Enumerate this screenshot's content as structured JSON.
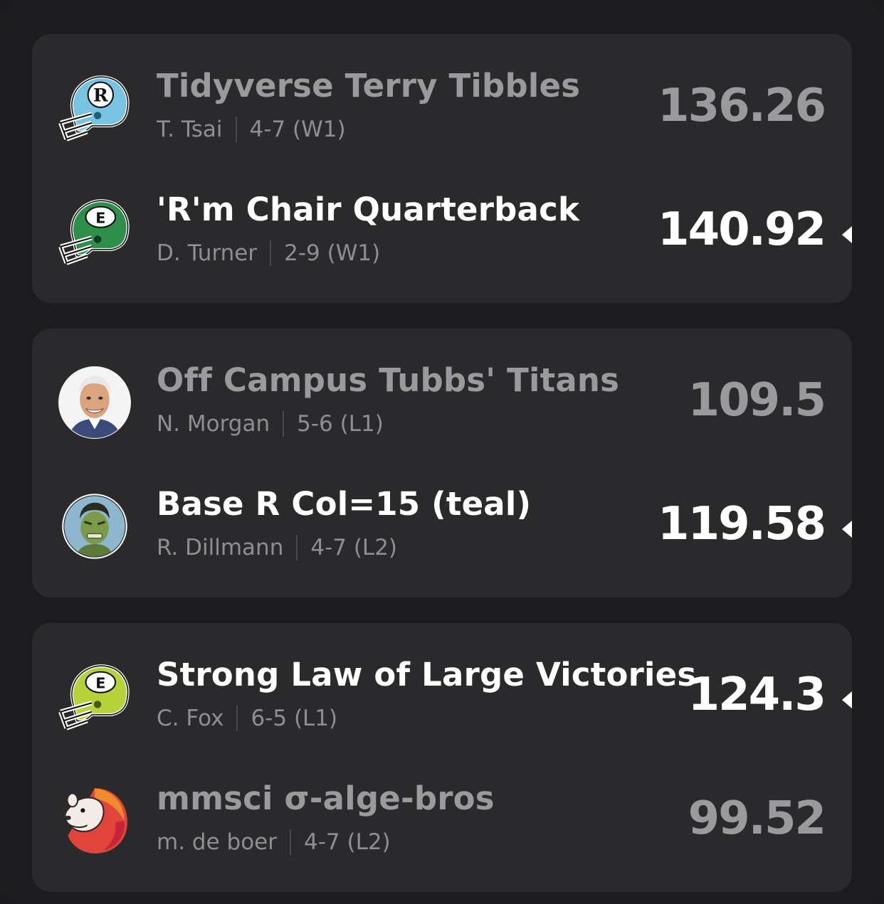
{
  "matchups": [
    {
      "teams": [
        {
          "name": "Tidyverse Terry Tibbles",
          "owner": "T. Tsai",
          "record": "4-7 (W1)",
          "score": "136.26",
          "winner": false,
          "avatar": "helmet-r-icon",
          "helmet_color": "#78c3e0"
        },
        {
          "name": "'R'm Chair Quarterback",
          "owner": "D. Turner",
          "record": "2-9 (W1)",
          "score": "140.92",
          "winner": true,
          "avatar": "helmet-e-icon",
          "helmet_color": "#2e8f4a"
        }
      ]
    },
    {
      "teams": [
        {
          "name": "Off Campus Tubbs' Titans",
          "owner": "N. Morgan",
          "record": "5-6 (L1)",
          "score": "109.5",
          "winner": false,
          "avatar": "person-photo-icon"
        },
        {
          "name": "Base R Col=15 (teal)",
          "owner": "R. Dillmann",
          "record": "4-7 (L2)",
          "score": "119.58",
          "winner": true,
          "avatar": "hulk-avatar-icon"
        }
      ]
    },
    {
      "teams": [
        {
          "name": "Strong Law of Large Victories",
          "owner": "C. Fox",
          "record": "6-5 (L1)",
          "score": "124.3",
          "winner": true,
          "avatar": "helmet-e-icon",
          "helmet_color": "#b6d43a"
        },
        {
          "name": "mmsci σ-alge-bros",
          "owner": "m. de boer",
          "record": "4-7 (L2)",
          "score": "99.52",
          "winner": false,
          "avatar": "lion-avatar-icon"
        }
      ]
    }
  ],
  "colors": {
    "background": "#1c1c1e",
    "card": "#2a2a2c",
    "winner_text": "#ffffff",
    "loser_text": "#9a9a9c"
  }
}
